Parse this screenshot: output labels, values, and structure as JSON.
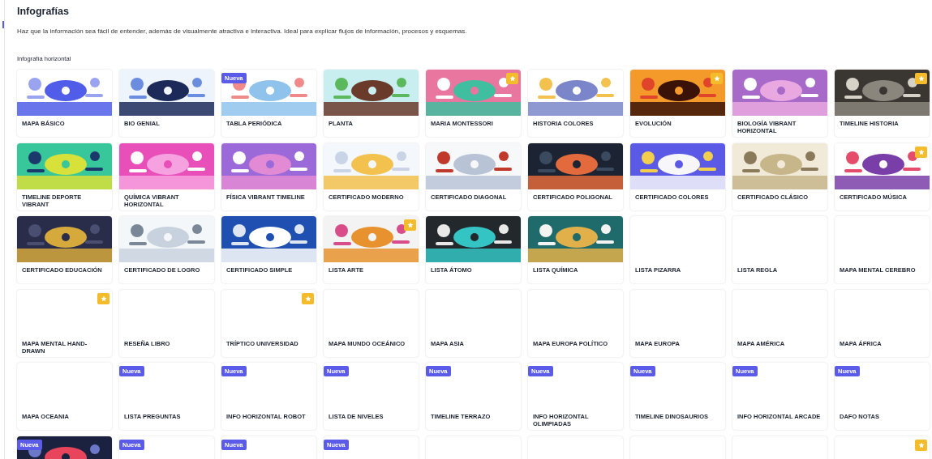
{
  "title": "Infografías",
  "description": "Haz que la información sea fácil de entender, además de visualmente atractiva e interactiva. Ideal para explicar flujos de información, procesos y esquemas.",
  "section": {
    "label": "Infografía horizontal",
    "cards": [
      {
        "title": "MAPA BÁSICO",
        "kind": "picture",
        "starred": false
      },
      {
        "title": "BIO GENIAL",
        "kind": "picture",
        "starred": false
      },
      {
        "title": "TABLA PERIÓDICA",
        "kind": "picture",
        "badge": "Nueva",
        "starred": false
      },
      {
        "title": "PLANTA",
        "kind": "picture",
        "starred": false
      },
      {
        "title": "MARIA MONTESSORI",
        "kind": "picture",
        "starred": true
      },
      {
        "title": "HISTORIA COLORES",
        "kind": "picture",
        "starred": false
      },
      {
        "title": "EVOLUCIÓN",
        "kind": "picture",
        "starred": true
      },
      {
        "title": "BIOLOGÍA VIBRANT HORIZONTAL",
        "kind": "picture",
        "starred": false
      },
      {
        "title": "TIMELINE HISTORIA",
        "kind": "picture",
        "starred": true
      },
      {
        "title": "TIMELINE DEPORTE VIBRANT",
        "kind": "picture",
        "starred": false
      },
      {
        "title": "QUÍMICA VIBRANT HORIZONTAL",
        "kind": "picture",
        "starred": false
      },
      {
        "title": "FÍSICA VIBRANT TIMELINE",
        "kind": "picture",
        "starred": false
      },
      {
        "title": "CERTIFICADO MODERNO",
        "kind": "picture",
        "starred": false
      },
      {
        "title": "CERTIFICADO DIAGONAL",
        "kind": "picture",
        "starred": false
      },
      {
        "title": "CERTIFICADO POLIGONAL",
        "kind": "picture",
        "starred": false
      },
      {
        "title": "CERTIFICADO COLORES",
        "kind": "picture",
        "starred": false
      },
      {
        "title": "CERTIFICADO CLÁSICO",
        "kind": "picture",
        "starred": false
      },
      {
        "title": "CERTIFICADO MÚSICA",
        "kind": "picture",
        "starred": true
      },
      {
        "title": "CERTIFICADO EDUCACIÓN",
        "kind": "picture",
        "starred": false
      },
      {
        "title": "CERTIFICADO DE LOGRO",
        "kind": "picture",
        "starred": false
      },
      {
        "title": "CERTIFICADO SIMPLE",
        "kind": "picture",
        "starred": false
      },
      {
        "title": "LISTA ARTE",
        "kind": "picture",
        "starred": true
      },
      {
        "title": "LISTA ÁTOMO",
        "kind": "picture",
        "starred": false
      },
      {
        "title": "LISTA QUÍMICA",
        "kind": "picture",
        "starred": false
      },
      {
        "title": "LISTA PIZARRA",
        "kind": "blank",
        "starred": false
      },
      {
        "title": "LISTA REGLA",
        "kind": "blank",
        "starred": false
      },
      {
        "title": "MAPA MENTAL CEREBRO",
        "kind": "blank",
        "starred": false
      },
      {
        "title": "MAPA MENTAL HAND-DRAWN",
        "kind": "blank",
        "starred": true
      },
      {
        "title": "RESEÑA LIBRO",
        "kind": "blank",
        "starred": false
      },
      {
        "title": "TRÍPTICO UNIVERSIDAD",
        "kind": "blank",
        "starred": true
      },
      {
        "title": "MAPA MUNDO OCEÁNICO",
        "kind": "blank",
        "starred": false
      },
      {
        "title": "MAPA ASIA",
        "kind": "blank",
        "starred": false
      },
      {
        "title": "MAPA EUROPA POLÍTICO",
        "kind": "blank",
        "starred": false
      },
      {
        "title": "MAPA EUROPA",
        "kind": "blank",
        "starred": false
      },
      {
        "title": "MAPA AMÉRICA",
        "kind": "blank",
        "starred": false
      },
      {
        "title": "MAPA ÁFRICA",
        "kind": "blank",
        "starred": false
      },
      {
        "title": "MAPA OCEANIA",
        "kind": "blank",
        "starred": false
      },
      {
        "title": "LISTA PREGUNTAS",
        "kind": "blank",
        "badge": "Nueva",
        "starred": false
      },
      {
        "title": "INFO HORIZONTAL ROBOT",
        "kind": "blank",
        "badge": "Nueva",
        "starred": false
      },
      {
        "title": "LISTA DE NIVELES",
        "kind": "blank",
        "badge": "Nueva",
        "starred": false
      },
      {
        "title": "TIMELINE TERRAZO",
        "kind": "blank",
        "badge": "Nueva",
        "starred": false
      },
      {
        "title": "INFO HORIZONTAL OLIMPIADAS",
        "kind": "blank",
        "badge": "Nueva",
        "starred": false
      },
      {
        "title": "TIMELINE DINOSAURIOS",
        "kind": "blank",
        "badge": "Nueva",
        "starred": false
      },
      {
        "title": "INFO HORIZONTAL ARCADE",
        "kind": "blank",
        "badge": "Nueva",
        "starred": false
      },
      {
        "title": "DAFO NOTAS",
        "kind": "blank",
        "badge": "Nueva",
        "starred": false
      },
      {
        "kind": "picture",
        "badge": "Nueva",
        "starred": false
      },
      {
        "kind": "blank",
        "badge": "Nueva",
        "starred": false
      },
      {
        "kind": "blank",
        "badge": "Nueva",
        "starred": false
      },
      {
        "kind": "blank",
        "badge": "Nueva",
        "starred": false
      },
      {
        "kind": "blank",
        "starred": false
      },
      {
        "kind": "blank",
        "starred": false
      },
      {
        "kind": "blank",
        "starred": false
      },
      {
        "kind": "blank",
        "starred": false
      },
      {
        "kind": "blank",
        "starred": true
      }
    ]
  }
}
